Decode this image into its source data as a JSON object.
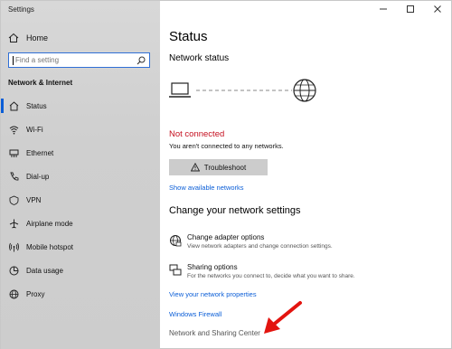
{
  "window": {
    "title": "Settings",
    "controls": {
      "minimize": "—",
      "maximize": "☐",
      "close": "✕"
    }
  },
  "sidebar": {
    "home_label": "Home",
    "search_placeholder": "Find a setting",
    "section_title": "Network & Internet",
    "items": [
      {
        "label": "Status",
        "icon": "home-globe-icon",
        "active": true
      },
      {
        "label": "Wi-Fi",
        "icon": "wifi-icon",
        "active": false
      },
      {
        "label": "Ethernet",
        "icon": "ethernet-icon",
        "active": false
      },
      {
        "label": "Dial-up",
        "icon": "dialup-icon",
        "active": false
      },
      {
        "label": "VPN",
        "icon": "vpn-icon",
        "active": false
      },
      {
        "label": "Airplane mode",
        "icon": "airplane-icon",
        "active": false
      },
      {
        "label": "Mobile hotspot",
        "icon": "hotspot-icon",
        "active": false
      },
      {
        "label": "Data usage",
        "icon": "data-usage-icon",
        "active": false
      },
      {
        "label": "Proxy",
        "icon": "globe-icon",
        "active": false
      }
    ]
  },
  "main": {
    "title": "Status",
    "network_status_heading": "Network status",
    "connection_state": "Not connected",
    "connection_desc": "You aren't connected to any networks.",
    "troubleshoot_label": "Troubleshoot",
    "show_networks_link": "Show available networks",
    "change_heading": "Change your network settings",
    "options": [
      {
        "title": "Change adapter options",
        "subtitle": "View network adapters and change connection settings.",
        "icon": "adapter-icon"
      },
      {
        "title": "Sharing options",
        "subtitle": "For the networks you connect to, decide what you want to share.",
        "icon": "sharing-icon"
      }
    ],
    "links": {
      "network_properties": "View your network properties",
      "windows_firewall": "Windows Firewall",
      "network_sharing_center": "Network and Sharing Center"
    }
  },
  "colors": {
    "accent": "#0b5ed7",
    "error": "#c50f1f",
    "annotation_arrow": "#e3140f"
  }
}
